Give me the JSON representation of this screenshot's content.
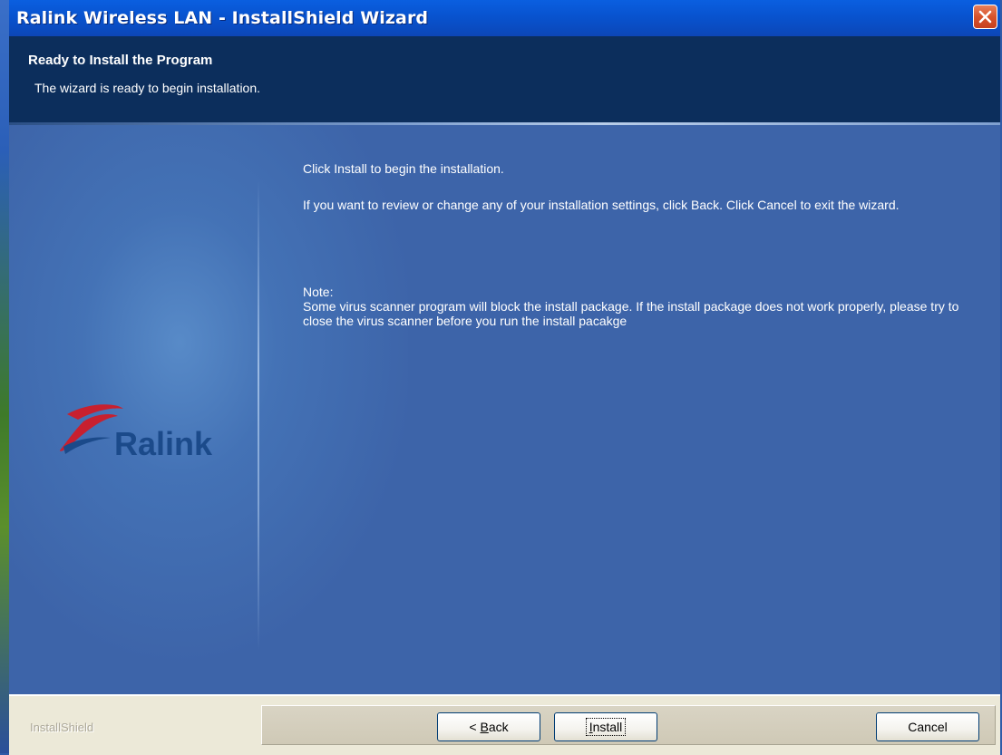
{
  "window": {
    "title": "Ralink Wireless LAN - InstallShield Wizard"
  },
  "header": {
    "title": "Ready to Install the Program",
    "subtitle": "The wizard is ready to begin installation."
  },
  "body": {
    "instruction": "Click Install to begin the installation.",
    "review": "If you want to review or change any of your installation settings, click Back. Click Cancel to exit the wizard.",
    "note_label": "Note:",
    "note_text": "Some virus scanner program will block the install package. If the install package does not work properly, please try to close the virus scanner before you run the install pacakge"
  },
  "logo": {
    "word": "Ralink"
  },
  "footer": {
    "brand": "InstallShield",
    "back_label_prefix": "< ",
    "back_label_mnemonic": "B",
    "back_label_rest": "ack",
    "install_label_mnemonic": "I",
    "install_label_rest": "nstall",
    "cancel_label": "Cancel"
  },
  "colors": {
    "titlebar": "#0853cf",
    "header_band": "#0c2e5c",
    "content_bg": "#3d64a9",
    "close_button": "#d8532c",
    "logo_red": "#c8202f",
    "logo_blue": "#1b4a8a"
  },
  "icons": {
    "close": "close-x-icon",
    "logo_swoosh": "ralink-swoosh-logo"
  }
}
